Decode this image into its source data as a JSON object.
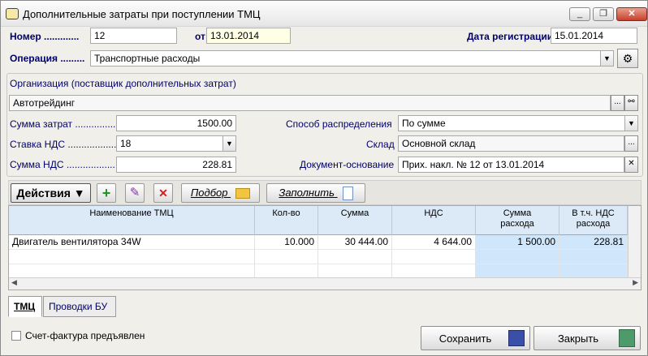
{
  "window": {
    "title": "Дополнительные затраты при поступлении ТМЦ",
    "minimize": "_",
    "restore": "❐",
    "close": "✕"
  },
  "header": {
    "number_label": "Номер",
    "number_value": "12",
    "from_label": "от",
    "from_value": "13.01.2014",
    "reg_date_label": "Дата регистрации",
    "reg_date_value": "15.01.2014",
    "operation_label": "Операция",
    "operation_value": "Транспортные расходы"
  },
  "form": {
    "org_label": "Организация (поставщик дополнительных затрат)",
    "org_value": "Автотрейдинг",
    "ellipsis": "...",
    "cost_sum_label": "Сумма затрат",
    "cost_sum_value": "1500.00",
    "vat_rate_label": "Ставка НДС",
    "vat_rate_value": "18",
    "vat_sum_label": "Сумма НДС",
    "vat_sum_value": "228.81",
    "distribution_label": "Способ распределения",
    "distribution_value": "По сумме",
    "warehouse_label": "Склад",
    "warehouse_value": "Основной склад",
    "basis_doc_label": "Документ-основание",
    "basis_doc_value": "Прих. накл. № 12 от 13.01.2014",
    "clear": "✕"
  },
  "toolbar": {
    "actions_label": "Действия",
    "add": "+",
    "edit": "✎",
    "delete": "✕",
    "pick_label": "Подбор",
    "fill_label": "Заполнить"
  },
  "grid": {
    "columns": [
      "Наименование ТМЦ",
      "Кол-во",
      "Сумма",
      "НДС",
      "Сумма расхода",
      "В т.ч. НДС расхода"
    ],
    "rows": [
      [
        "Двигатель вентилятора 34W",
        "10.000",
        "30 444.00",
        "4 644.00",
        "1 500.00",
        "228.81"
      ]
    ]
  },
  "tabs": [
    "ТМЦ",
    "Проводки БУ"
  ],
  "footer": {
    "invoice_checkbox_label": "Счет-фактура предъявлен",
    "save_label": "Сохранить",
    "close_label": "Закрыть"
  },
  "colors": {
    "label": "#00006E",
    "header_bg": "#DCE9F7",
    "highlight": "#CFE6FB"
  }
}
